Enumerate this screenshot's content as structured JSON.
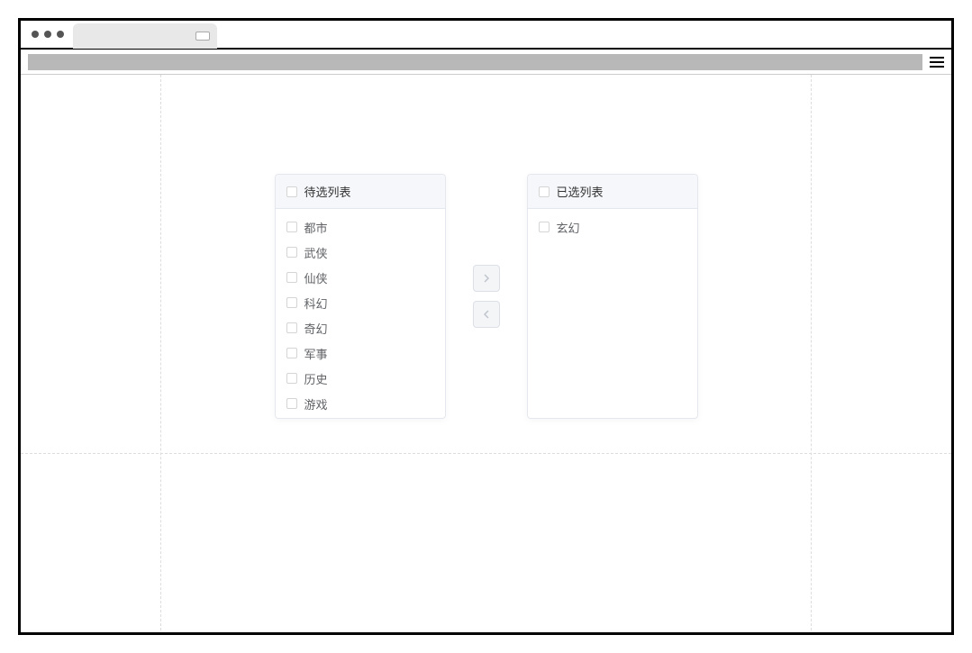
{
  "transfer": {
    "source_title": "待选列表",
    "target_title": "已选列表",
    "source_items": [
      {
        "label": "都市"
      },
      {
        "label": "武侠"
      },
      {
        "label": "仙侠"
      },
      {
        "label": "科幻"
      },
      {
        "label": "奇幻"
      },
      {
        "label": "军事"
      },
      {
        "label": "历史"
      },
      {
        "label": "游戏"
      }
    ],
    "target_items": [
      {
        "label": "玄幻"
      }
    ]
  }
}
